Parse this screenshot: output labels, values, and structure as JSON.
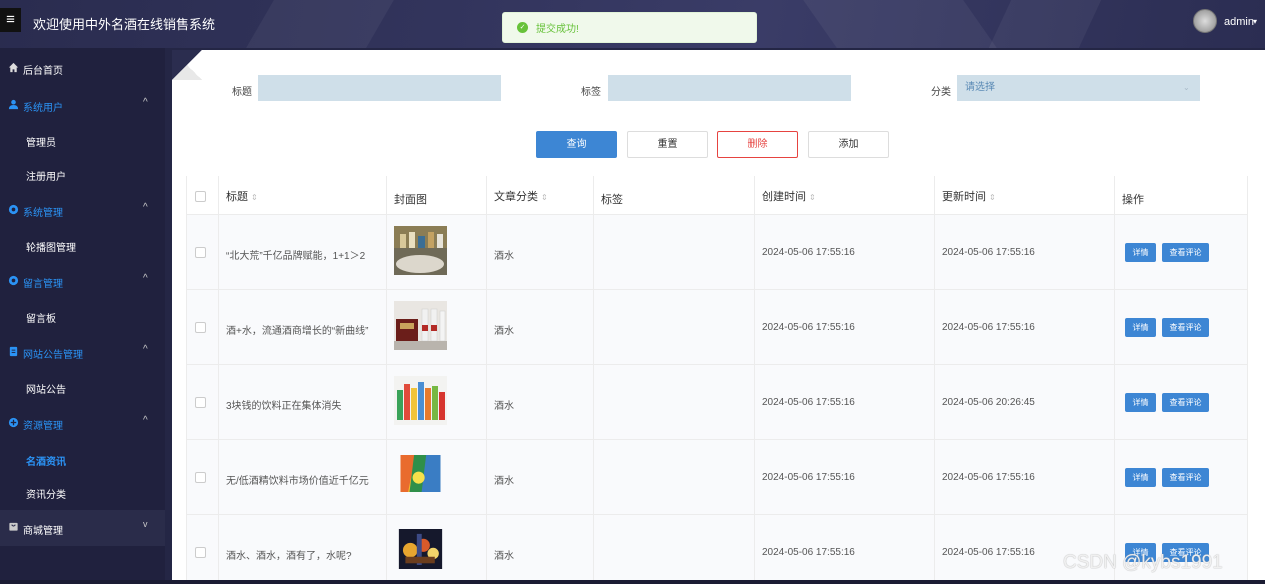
{
  "header": {
    "menu_icon": "hamburger-icon",
    "title": "欢迎使用中外名酒在线销售系统",
    "user": "admin",
    "caret": "▾",
    "colors": {
      "bg": "#2f315a",
      "text": "#ffffff"
    }
  },
  "toast": {
    "icon": "check-circle-icon",
    "message": "提交成功!",
    "color": "#67c23a"
  },
  "sidebar": {
    "items": [
      {
        "label": "后台首页",
        "icon": "home-icon"
      },
      {
        "label": "系统用户",
        "icon": "user-icon",
        "chevron": "^"
      },
      {
        "label": "管理员"
      },
      {
        "label": "注册用户"
      },
      {
        "label": "系统管理",
        "icon": "gear-icon",
        "chevron": "^"
      },
      {
        "label": "轮播图管理"
      },
      {
        "label": "留言管理",
        "icon": "gear-icon",
        "chevron": "^"
      },
      {
        "label": "留言板"
      },
      {
        "label": "网站公告管理",
        "icon": "document-icon",
        "chevron": "^"
      },
      {
        "label": "网站公告"
      },
      {
        "label": "资源管理",
        "icon": "plus-circle-icon",
        "chevron": "^"
      },
      {
        "label": "名酒资讯"
      },
      {
        "label": "资讯分类"
      },
      {
        "label": "商城管理",
        "icon": "shop-icon",
        "chevron": "v"
      }
    ],
    "accent": "#2b93f5"
  },
  "filters": {
    "title_label": "标题",
    "tag_label": "标签",
    "category_label": "分类",
    "category_placeholder": "请选择",
    "caret": "⌄"
  },
  "buttons": {
    "search": "查询",
    "reset": "重置",
    "delete": "删除",
    "add": "添加"
  },
  "table": {
    "headers": [
      "标题",
      "封面图",
      "文章分类",
      "标签",
      "创建时间",
      "更新时间",
      "操作"
    ],
    "sort_icon": "⇕",
    "rows": [
      {
        "title": "“北大荒”千亿品牌赋能，1+1＞2",
        "category": "酒水",
        "tag": "",
        "created": "2024-05-06 17:55:16",
        "updated": "2024-05-06 17:55:16"
      },
      {
        "title": "酒+水，流通酒商增长的“新曲线”",
        "category": "酒水",
        "tag": "",
        "created": "2024-05-06 17:55:16",
        "updated": "2024-05-06 17:55:16"
      },
      {
        "title": "3块钱的饮料正在集体消失",
        "category": "酒水",
        "tag": "",
        "created": "2024-05-06 17:55:16",
        "updated": "2024-05-06 20:26:45"
      },
      {
        "title": "无/低酒精饮料市场价值近千亿元",
        "category": "酒水",
        "tag": "",
        "created": "2024-05-06 17:55:16",
        "updated": "2024-05-06 17:55:16"
      },
      {
        "title": "酒水、酒水，酒有了，水呢?",
        "category": "酒水",
        "tag": "",
        "created": "2024-05-06 17:55:16",
        "updated": "2024-05-06 17:55:16"
      }
    ],
    "detail_label": "详情",
    "comments_label": "查看评论"
  },
  "watermark": "CSDN @kybs1991"
}
